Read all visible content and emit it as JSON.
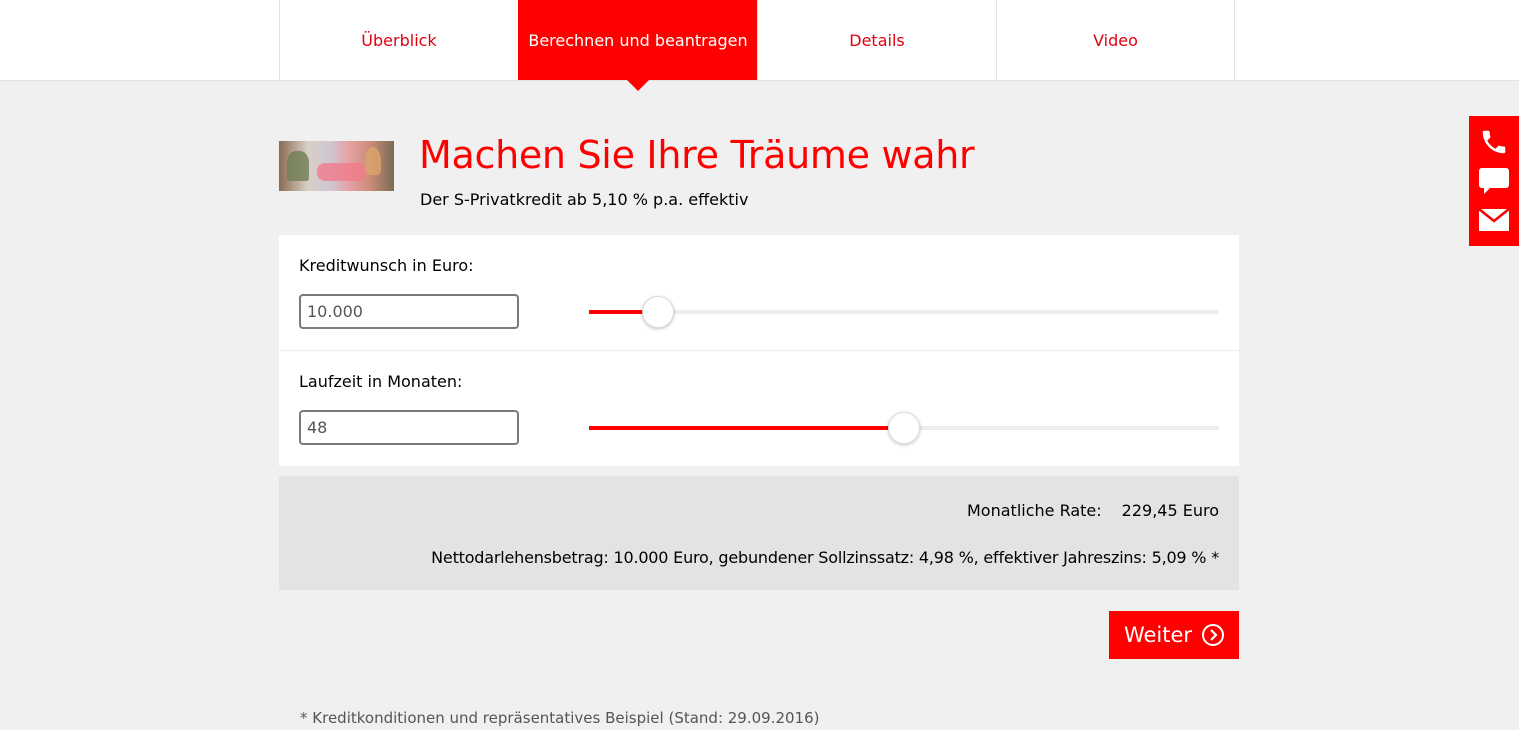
{
  "nav": {
    "tabs": [
      {
        "label": "Überblick",
        "active": false
      },
      {
        "label": "Berechnen und beantragen",
        "active": true
      },
      {
        "label": "Details",
        "active": false
      },
      {
        "label": "Video",
        "active": false
      }
    ]
  },
  "side_contact": {
    "icons": [
      "phone-icon",
      "chat-icon",
      "mail-icon"
    ]
  },
  "header": {
    "headline": "Machen Sie Ihre Träume wahr",
    "subline": "Der S-Privatkredit ab 5,10 % p.a. effektiv"
  },
  "calculator": {
    "amount": {
      "label": "Kreditwunsch in Euro:",
      "value": "10.000",
      "slider_percent": 11
    },
    "term": {
      "label": "Laufzeit in Monaten:",
      "value": "48",
      "slider_percent": 50
    }
  },
  "result": {
    "rate_label": "Monatliche Rate:",
    "rate_value": "229,45 Euro",
    "details": "Nettodarlehensbetrag: 10.000 Euro, gebundener Sollzinssatz: 4,98 %, effektiver Jahreszins: 5,09 % *"
  },
  "actions": {
    "next_label": "Weiter"
  },
  "footnote": "* Kreditkonditionen und repräsentatives Beispiel (Stand: 29.09.2016)",
  "colors": {
    "brand_red": "#ff0000",
    "page_bg": "#f0f0f0"
  }
}
